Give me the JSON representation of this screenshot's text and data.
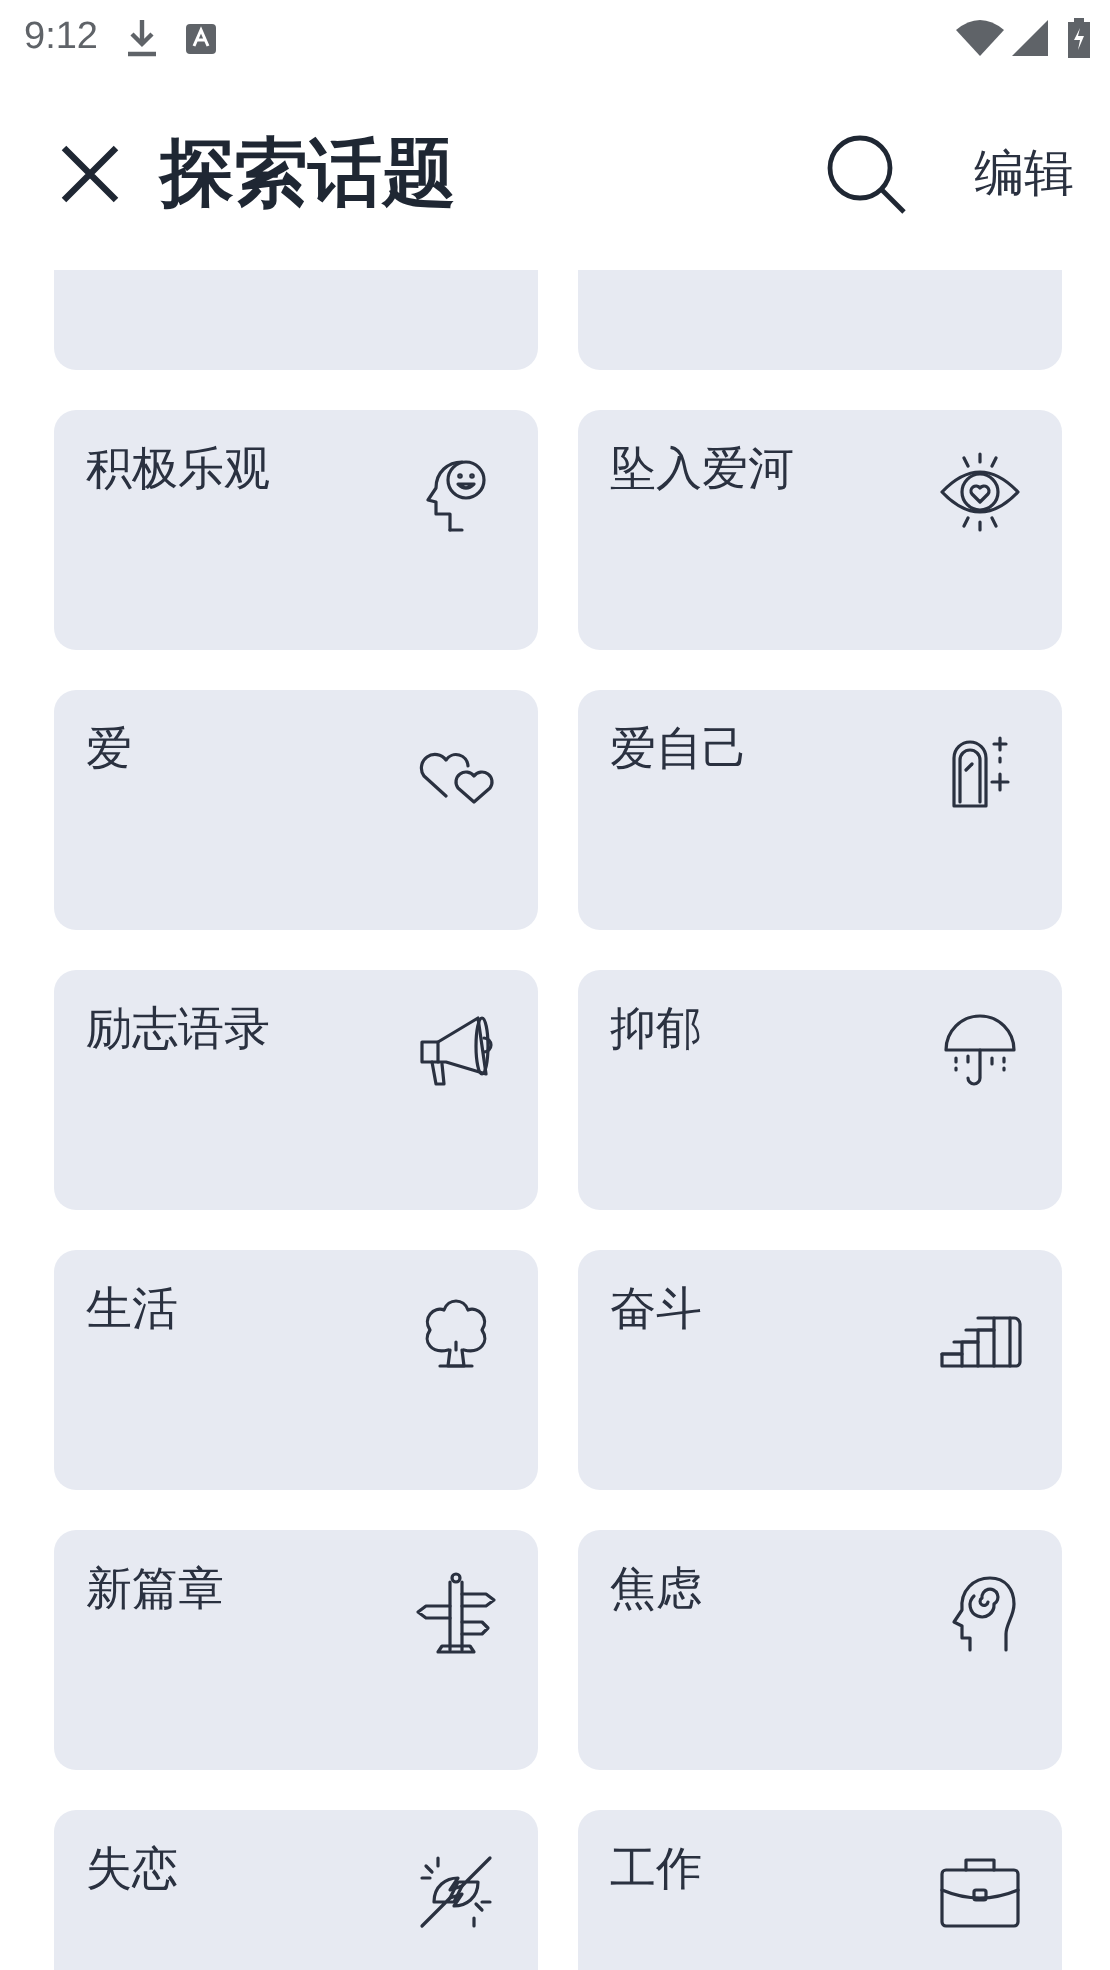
{
  "status_bar": {
    "time": "9:12"
  },
  "header": {
    "title": "探索话题",
    "edit": "编辑"
  },
  "topics": [
    {
      "label": "积极乐观",
      "kind": "head"
    },
    {
      "label": "坠入爱河",
      "kind": "eye"
    },
    {
      "label": "爱",
      "kind": "hearts"
    },
    {
      "label": "爱自己",
      "kind": "mirror"
    },
    {
      "label": "励志语录",
      "kind": "megaphone"
    },
    {
      "label": "抑郁",
      "kind": "umbrella"
    },
    {
      "label": "生活",
      "kind": "tree"
    },
    {
      "label": "奋斗",
      "kind": "stairs"
    },
    {
      "label": "新篇章",
      "kind": "signpost"
    },
    {
      "label": "焦虑",
      "kind": "spiral"
    },
    {
      "label": "失恋",
      "kind": "broken"
    },
    {
      "label": "工作",
      "kind": "briefcase"
    }
  ]
}
